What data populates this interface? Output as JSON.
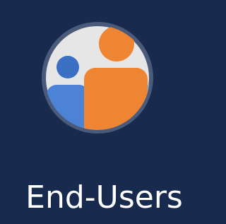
{
  "tile": {
    "label": "End-Users",
    "icon": "users-group-icon"
  },
  "colors": {
    "background": "#182a4e",
    "circle_fill": "#e6e6e6",
    "circle_border": "#4a5a7a",
    "center_person": "#ee8533",
    "left_person_head": "#3a6fc4",
    "left_person_body": "#4c83d4",
    "right_person_head": "#5b9fe0",
    "right_person_body": "#6aaeea",
    "label": "#ffffff"
  }
}
